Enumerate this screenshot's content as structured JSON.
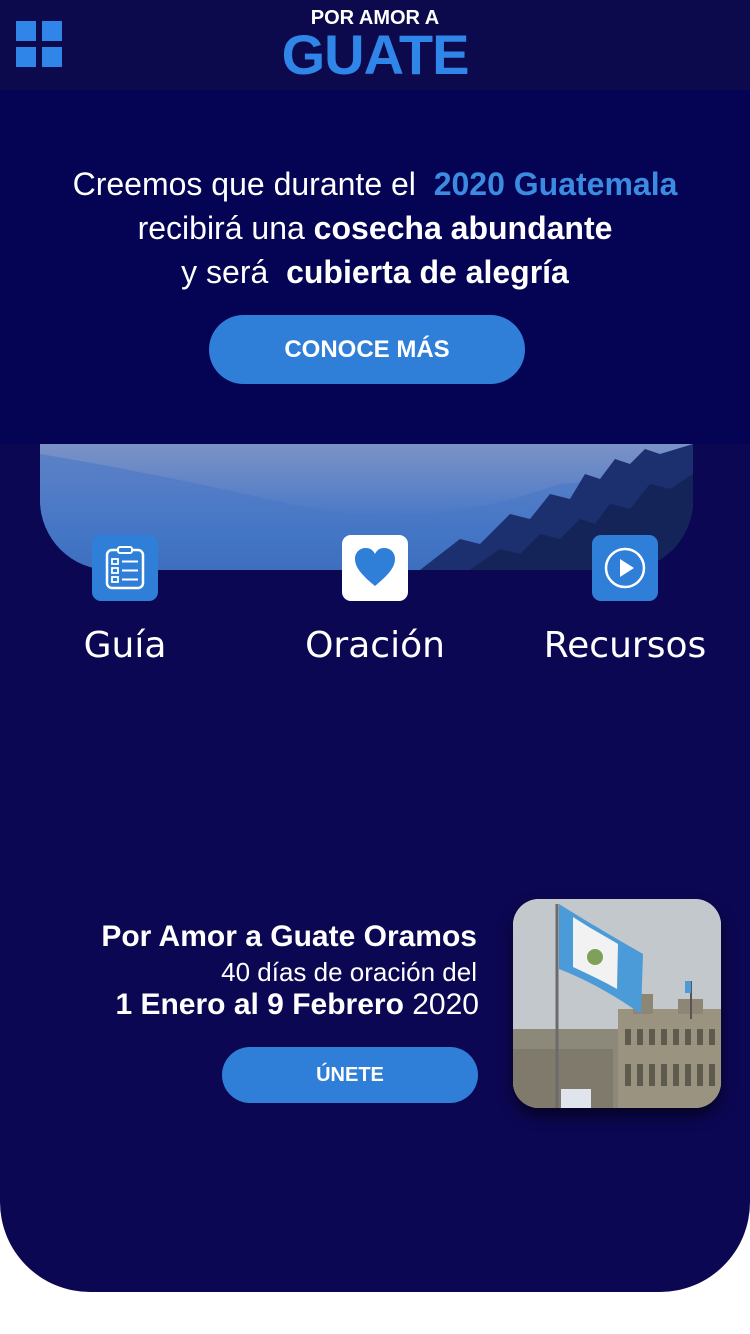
{
  "header": {
    "logo_top": "POR AMOR A",
    "logo_main": "GUATE",
    "menu_icon": "grid-menu-icon"
  },
  "hero": {
    "line1_prefix": "Creemos que durante el",
    "line1_accent": "2020 Guatemala",
    "line2_prefix": "recibirá una",
    "line2_bold": "cosecha abundante",
    "line3_prefix": "y será",
    "line3_bold": "cubierta de alegría",
    "button_label": "CONOCE MÁS"
  },
  "features": [
    {
      "label": "Guía",
      "icon": "checklist-icon"
    },
    {
      "label": "Oración",
      "icon": "heart-icon"
    },
    {
      "label": "Recursos",
      "icon": "play-icon"
    }
  ],
  "promo": {
    "title": "Por Amor a Guate Oramos",
    "subtitle": "40 días de oración del",
    "dates_bold": "1 Enero al 9 Febrero",
    "dates_year": "2020",
    "button_label": "ÚNETE"
  },
  "colors": {
    "background": "#0c0752",
    "accent": "#2f86e8",
    "button": "#2f7fd8",
    "text": "#ffffff"
  }
}
